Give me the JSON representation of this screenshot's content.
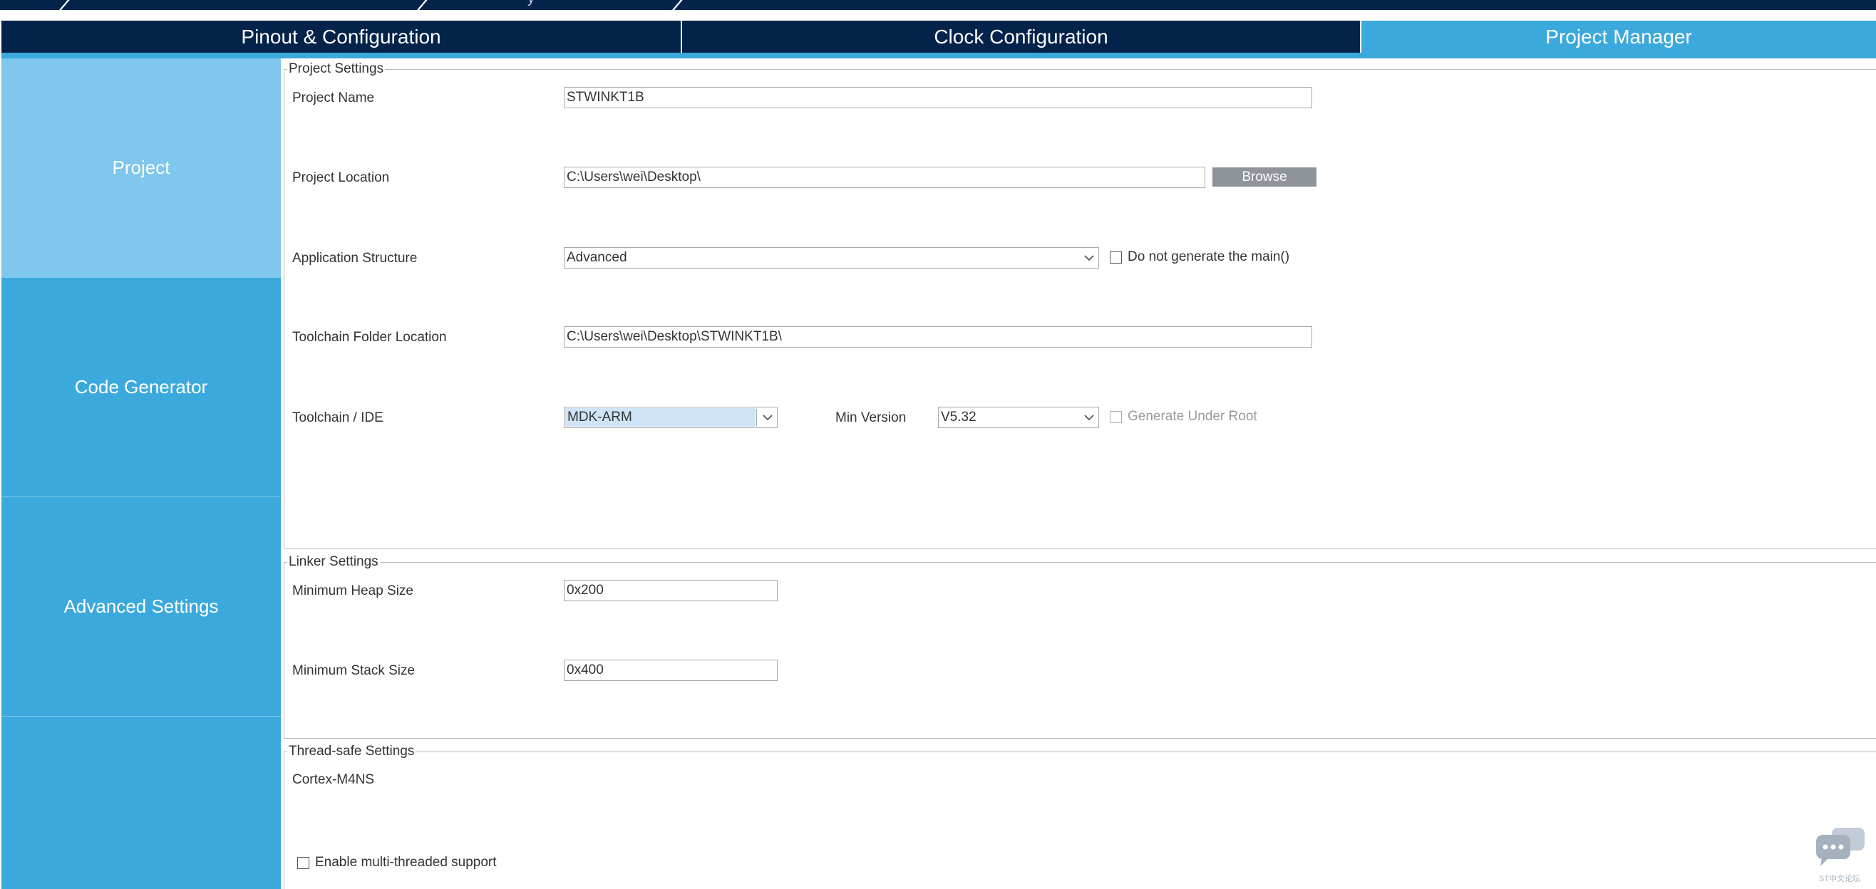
{
  "breadcrumb": {
    "partial_text": "y"
  },
  "tabs": [
    {
      "label": "Pinout & Configuration"
    },
    {
      "label": "Clock Configuration"
    },
    {
      "label": "Project Manager"
    }
  ],
  "side_nav": [
    {
      "label": "Project"
    },
    {
      "label": "Code Generator"
    },
    {
      "label": "Advanced Settings"
    }
  ],
  "project_settings": {
    "legend": "Project Settings",
    "project_name_label": "Project Name",
    "project_name_value": "STWINKT1B",
    "project_location_label": "Project Location",
    "project_location_value": "C:\\Users\\wei\\Desktop\\",
    "browse_label": "Browse",
    "app_structure_label": "Application Structure",
    "app_structure_value": "Advanced",
    "no_main_label": "Do not generate the main()",
    "toolchain_folder_label": "Toolchain Folder Location",
    "toolchain_folder_value": "C:\\Users\\wei\\Desktop\\STWINKT1B\\",
    "toolchain_ide_label": "Toolchain / IDE",
    "toolchain_ide_value": "MDK-ARM",
    "min_version_label": "Min Version",
    "min_version_value": "V5.32",
    "generate_under_root_label": "Generate Under Root"
  },
  "linker_settings": {
    "legend": "Linker Settings",
    "heap_label": "Minimum Heap Size",
    "heap_value": "0x200",
    "stack_label": "Minimum Stack Size",
    "stack_value": "0x400"
  },
  "thread_safe_settings": {
    "legend": "Thread-safe Settings",
    "core_label": "Cortex-M4NS",
    "multithread_label": "Enable multi-threaded support"
  },
  "watermark": {
    "text": "ST中文论坛"
  },
  "colors": {
    "navy": "#03234b",
    "accent_blue": "#3ca9dc",
    "active_side": "#7fc7ec",
    "button_gray": "#8f949b",
    "selection_blue": "#cfe4f7"
  }
}
